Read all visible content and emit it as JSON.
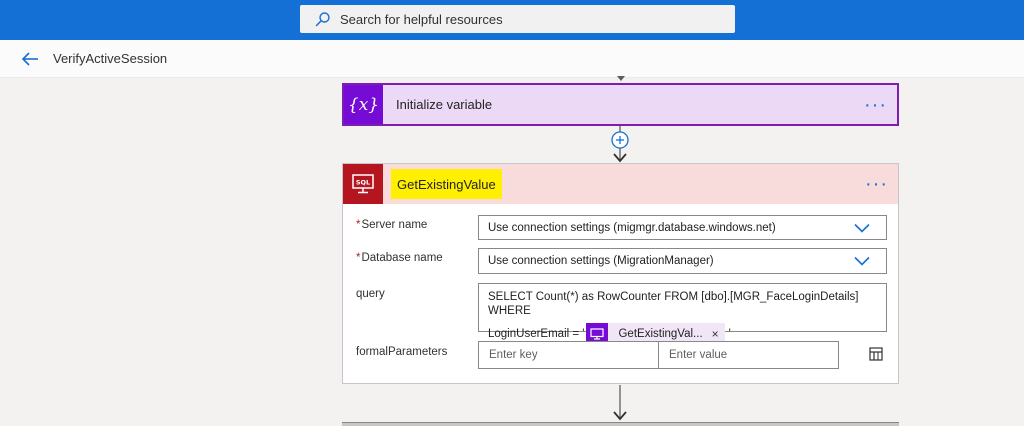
{
  "search": {
    "placeholder": "Search for helpful resources",
    "icon": "search-icon"
  },
  "header": {
    "title": "VerifyActiveSession",
    "back_icon": "back-arrow-icon"
  },
  "steps": {
    "init_variable": {
      "label": "Initialize variable",
      "icon": "variable-icon",
      "icon_glyph": "{x}",
      "more": "···",
      "accent": "#770bd6"
    },
    "add_step": {
      "icon": "plus-circle-icon"
    },
    "sql": {
      "title": "GetExistingValue",
      "icon": "sql-server-icon",
      "icon_text": "SQL",
      "more": "···",
      "accent": "#b5151e",
      "highlight": "#ffef00",
      "server_label": "Server name",
      "server_value": "Use connection settings (migmgr.database.windows.net)",
      "database_label": "Database name",
      "database_value": "Use connection settings (MigrationManager)",
      "required_mark": "*",
      "query_label": "query",
      "query_line1": "SELECT Count(*) as RowCounter FROM [dbo].[MGR_FaceLoginDetails] WHERE",
      "query_line2_prefix": "LoginUserEmail = '",
      "query_token": "GetExistingVal...",
      "query_token_close": "×",
      "query_suffix": "'",
      "formal_label": "formalParameters",
      "key_placeholder": "Enter key",
      "value_placeholder": "Enter value",
      "table_icon": "table-edit-icon"
    }
  }
}
